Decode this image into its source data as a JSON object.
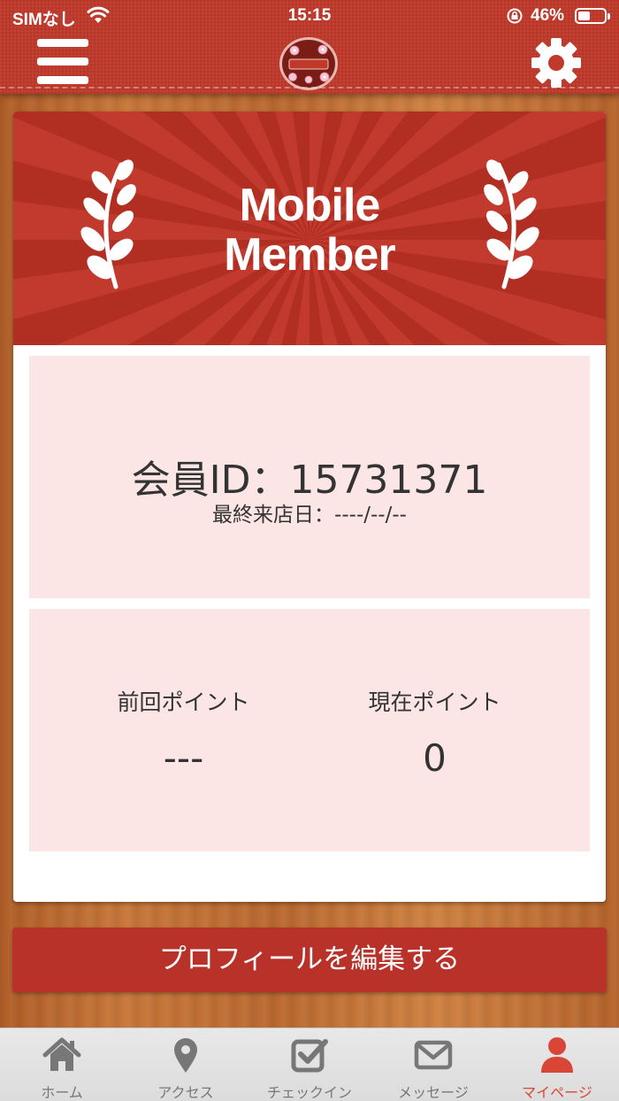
{
  "status_bar": {
    "carrier": "SIMなし",
    "time": "15:15",
    "battery_percent": "46%",
    "battery_level": 0.46
  },
  "header": {
    "menu_icon": "hamburger-menu-icon",
    "logo_icon": "sakura-logo-icon",
    "settings_icon": "gear-icon"
  },
  "card": {
    "banner_title_line1": "Mobile",
    "banner_title_line2": "Member",
    "member_id_label": "会員ID：",
    "member_id": "15731371",
    "last_visit_label": "最終来店日：",
    "last_visit_date": "----/--/--",
    "previous_points_label": "前回ポイント",
    "previous_points_value": "---",
    "current_points_label": "現在ポイント",
    "current_points_value": "0"
  },
  "actions": {
    "edit_profile_label": "プロフィールを編集する"
  },
  "tabbar": {
    "tabs": [
      {
        "label": "ホーム",
        "icon": "home-icon"
      },
      {
        "label": "アクセス",
        "icon": "map-pin-icon"
      },
      {
        "label": "チェックイン",
        "icon": "checkbox-icon"
      },
      {
        "label": "メッセージ",
        "icon": "envelope-icon"
      },
      {
        "label": "マイページ",
        "icon": "person-icon"
      }
    ],
    "active_index": 4
  },
  "colors": {
    "header_red": "#c0392b",
    "button_red": "#b8322a",
    "panel_pink": "#fbe6e5",
    "active_tab": "#d94636",
    "inactive_tab": "#777777"
  }
}
